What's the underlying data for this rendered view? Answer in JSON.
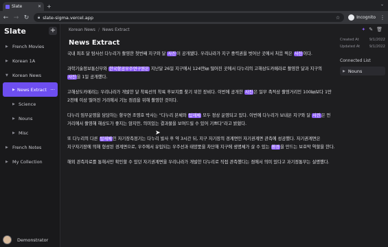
{
  "browser": {
    "tab_title": "Slate",
    "url": "slate-sigma.vercel.app",
    "profile": "Incognito"
  },
  "sidebar": {
    "brand": "Slate",
    "add_label": "+",
    "items": [
      {
        "label": "French Movies",
        "level": 0,
        "expanded": false
      },
      {
        "label": "Korean 1A",
        "level": 0,
        "expanded": false
      },
      {
        "label": "Korean News",
        "level": 0,
        "expanded": true
      },
      {
        "label": "News Extract",
        "level": 1,
        "expanded": false,
        "active": true
      },
      {
        "label": "Science",
        "level": 1,
        "expanded": false
      },
      {
        "label": "Nouns",
        "level": 1,
        "expanded": false
      },
      {
        "label": "Misc",
        "level": 1,
        "expanded": false
      },
      {
        "label": "French Notes",
        "level": 0,
        "expanded": false
      },
      {
        "label": "My Collection",
        "level": 0,
        "expanded": false
      }
    ],
    "more_label": "···",
    "user_name": "Demonstrator"
  },
  "main": {
    "breadcrumb": [
      "Korean News",
      "News Extract"
    ],
    "breadcrumb_sep": "/",
    "title": "News Extract",
    "paragraphs": [
      {
        "segments": [
          {
            "t": "국내 최초 달 탐사선 다누리가 촬영한 첫번째 지구와 달 "
          },
          {
            "t": "사진",
            "h": true
          },
          {
            "t": "이 공개됐다. 우리나라가 지구 중력권을 벗어난 곳에서 처음 찍은 "
          },
          {
            "t": "사진",
            "h": true
          },
          {
            "t": "이다."
          }
        ]
      },
      {
        "segments": [
          {
            "t": "과학기술정보통신부와 "
          },
          {
            "t": "한국항공우주연구원은",
            "h": true
          },
          {
            "t": " 지난달 26일 지구에서 124만㎞ 떨어진 곳에서 다누리의 고해상도카메라로 촬영한 달과 지구의 "
          },
          {
            "t": "사진",
            "h": true
          },
          {
            "t": "을 1일 공개했다."
          }
        ]
      },
      {
        "segments": [
          {
            "t": "고해상도카메라는 우리나라가 개발한 달 착륙선의 착륙 후보지를 찾기 위한 장비다. 이번에 공개한 "
          },
          {
            "t": "사진",
            "h": true
          },
          {
            "t": "은 일부 촉적상 촬영거리인 100㎞보다 1만 2천배 이상 떨어진 거리에서 기능 점검을 위해 촬영한 것이다."
          }
        ]
      },
      {
        "segments": [
          {
            "t": "다누리 임무운영을 담당하는 항우연 조영호 박사는 “다누리 본체와 "
          },
          {
            "t": "탑재체",
            "h": true
          },
          {
            "t": " 모두 정상 운영되고 있다. 이번에 다누리가 보내온 지구와 달 "
          },
          {
            "t": "사진",
            "h": true
          },
          {
            "t": "은 먼 거리에서 촬영해 해상도가 좋지는 않지만, 의미있는 결과물을 보여드릴 수 있어 기쁘다”라고 밝혔다."
          }
        ]
      },
      {
        "segments": [
          {
            "t": "또 다누리의 다른 "
          },
          {
            "t": "탑재체",
            "h": true
          },
          {
            "t": "인 자기장측정기는 다누리 발사 후 약 3시간 뒤, 지구 자기장의 경계면인 자기권계면 관측에 성공했다. 자기권계면은 지구자기장에 의해 형성된 경계면으로, 우주에서 유입되는 우주선과 태양풍을 차단해 지구에 생명체가 살 수 있는 "
          },
          {
            "t": "환경",
            "h": true
          },
          {
            "t": "을 만드는 보호막 역할을 한다."
          }
        ]
      },
      {
        "segments": [
          {
            "t": "해외 관측자료를 통해서만 확인할 수 있던 자기권계면을 우리나라가 개발한 다누리로 직접 관측했다는 점에서 의미 있다고 과기정통부는 설명했다."
          }
        ]
      }
    ]
  },
  "panel": {
    "created_label": "Created At",
    "created_value": "9/1/2022",
    "updated_label": "Updated At",
    "updated_value": "9/1/2022",
    "connected_title": "Connected List",
    "connected_items": [
      "Nouns"
    ]
  },
  "colors": {
    "accent": "#6d4ef0",
    "highlight": "#8b5cf6",
    "background": "#1e1e20",
    "sidebar": "#19191b"
  },
  "icons": {
    "wand": "magic-wand-icon",
    "edit": "edit-icon",
    "delete": "trash-icon"
  }
}
